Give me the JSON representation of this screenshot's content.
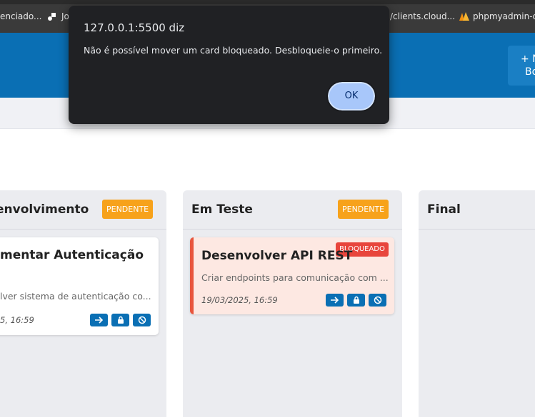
{
  "bookmarks": [
    {
      "label": "enciado...",
      "icon": "site-icon"
    },
    {
      "label": "Jo",
      "icon": "app-icon"
    },
    {
      "label": "/clients.cloud...",
      "icon": ""
    },
    {
      "label": "phpmyadmin-c",
      "icon": "phpmyadmin-icon"
    }
  ],
  "header": {
    "new_board_symbol": "+ N",
    "new_board_label": "Bo"
  },
  "columns": [
    {
      "title": "envolvimento",
      "badge": "PENDENTE",
      "cards": [
        {
          "title": "mentar Autenticação",
          "description": "lver sistema de autenticação co...",
          "date": "5, 16:59",
          "blocked": false
        }
      ]
    },
    {
      "title": "Em Teste",
      "badge": "PENDENTE",
      "cards": [
        {
          "title": "Desenvolver API REST",
          "description": "Criar endpoints para comunicação com ...",
          "date": "19/03/2025, 16:59",
          "blocked": true,
          "blocked_label": "BLOQUEADO"
        }
      ]
    },
    {
      "title": "Final",
      "badge": "",
      "cards": []
    }
  ],
  "card_actions": [
    "arrow-right-icon",
    "lock-icon",
    "block-icon"
  ],
  "dialog": {
    "title": "127.0.0.1:5500 diz",
    "message": "Não é possível mover um card bloqueado. Desbloqueie-o primeiro.",
    "ok_label": "OK"
  },
  "colors": {
    "header_blue": "#0a6fb4",
    "badge_orange": "#f7a21b",
    "blocked_red": "#e8453c",
    "dialog_bg": "#202124",
    "ok_button": "#a8c7fa"
  }
}
